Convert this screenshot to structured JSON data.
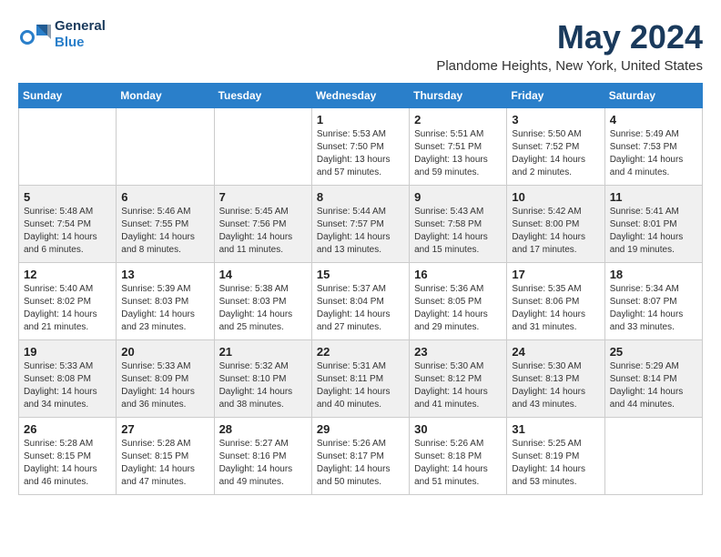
{
  "header": {
    "logo_line1": "General",
    "logo_line2": "Blue",
    "month": "May 2024",
    "location": "Plandome Heights, New York, United States"
  },
  "weekdays": [
    "Sunday",
    "Monday",
    "Tuesday",
    "Wednesday",
    "Thursday",
    "Friday",
    "Saturday"
  ],
  "weeks": [
    [
      {
        "day": "",
        "text": ""
      },
      {
        "day": "",
        "text": ""
      },
      {
        "day": "",
        "text": ""
      },
      {
        "day": "1",
        "text": "Sunrise: 5:53 AM\nSunset: 7:50 PM\nDaylight: 13 hours\nand 57 minutes."
      },
      {
        "day": "2",
        "text": "Sunrise: 5:51 AM\nSunset: 7:51 PM\nDaylight: 13 hours\nand 59 minutes."
      },
      {
        "day": "3",
        "text": "Sunrise: 5:50 AM\nSunset: 7:52 PM\nDaylight: 14 hours\nand 2 minutes."
      },
      {
        "day": "4",
        "text": "Sunrise: 5:49 AM\nSunset: 7:53 PM\nDaylight: 14 hours\nand 4 minutes."
      }
    ],
    [
      {
        "day": "5",
        "text": "Sunrise: 5:48 AM\nSunset: 7:54 PM\nDaylight: 14 hours\nand 6 minutes."
      },
      {
        "day": "6",
        "text": "Sunrise: 5:46 AM\nSunset: 7:55 PM\nDaylight: 14 hours\nand 8 minutes."
      },
      {
        "day": "7",
        "text": "Sunrise: 5:45 AM\nSunset: 7:56 PM\nDaylight: 14 hours\nand 11 minutes."
      },
      {
        "day": "8",
        "text": "Sunrise: 5:44 AM\nSunset: 7:57 PM\nDaylight: 14 hours\nand 13 minutes."
      },
      {
        "day": "9",
        "text": "Sunrise: 5:43 AM\nSunset: 7:58 PM\nDaylight: 14 hours\nand 15 minutes."
      },
      {
        "day": "10",
        "text": "Sunrise: 5:42 AM\nSunset: 8:00 PM\nDaylight: 14 hours\nand 17 minutes."
      },
      {
        "day": "11",
        "text": "Sunrise: 5:41 AM\nSunset: 8:01 PM\nDaylight: 14 hours\nand 19 minutes."
      }
    ],
    [
      {
        "day": "12",
        "text": "Sunrise: 5:40 AM\nSunset: 8:02 PM\nDaylight: 14 hours\nand 21 minutes."
      },
      {
        "day": "13",
        "text": "Sunrise: 5:39 AM\nSunset: 8:03 PM\nDaylight: 14 hours\nand 23 minutes."
      },
      {
        "day": "14",
        "text": "Sunrise: 5:38 AM\nSunset: 8:03 PM\nDaylight: 14 hours\nand 25 minutes."
      },
      {
        "day": "15",
        "text": "Sunrise: 5:37 AM\nSunset: 8:04 PM\nDaylight: 14 hours\nand 27 minutes."
      },
      {
        "day": "16",
        "text": "Sunrise: 5:36 AM\nSunset: 8:05 PM\nDaylight: 14 hours\nand 29 minutes."
      },
      {
        "day": "17",
        "text": "Sunrise: 5:35 AM\nSunset: 8:06 PM\nDaylight: 14 hours\nand 31 minutes."
      },
      {
        "day": "18",
        "text": "Sunrise: 5:34 AM\nSunset: 8:07 PM\nDaylight: 14 hours\nand 33 minutes."
      }
    ],
    [
      {
        "day": "19",
        "text": "Sunrise: 5:33 AM\nSunset: 8:08 PM\nDaylight: 14 hours\nand 34 minutes."
      },
      {
        "day": "20",
        "text": "Sunrise: 5:33 AM\nSunset: 8:09 PM\nDaylight: 14 hours\nand 36 minutes."
      },
      {
        "day": "21",
        "text": "Sunrise: 5:32 AM\nSunset: 8:10 PM\nDaylight: 14 hours\nand 38 minutes."
      },
      {
        "day": "22",
        "text": "Sunrise: 5:31 AM\nSunset: 8:11 PM\nDaylight: 14 hours\nand 40 minutes."
      },
      {
        "day": "23",
        "text": "Sunrise: 5:30 AM\nSunset: 8:12 PM\nDaylight: 14 hours\nand 41 minutes."
      },
      {
        "day": "24",
        "text": "Sunrise: 5:30 AM\nSunset: 8:13 PM\nDaylight: 14 hours\nand 43 minutes."
      },
      {
        "day": "25",
        "text": "Sunrise: 5:29 AM\nSunset: 8:14 PM\nDaylight: 14 hours\nand 44 minutes."
      }
    ],
    [
      {
        "day": "26",
        "text": "Sunrise: 5:28 AM\nSunset: 8:15 PM\nDaylight: 14 hours\nand 46 minutes."
      },
      {
        "day": "27",
        "text": "Sunrise: 5:28 AM\nSunset: 8:15 PM\nDaylight: 14 hours\nand 47 minutes."
      },
      {
        "day": "28",
        "text": "Sunrise: 5:27 AM\nSunset: 8:16 PM\nDaylight: 14 hours\nand 49 minutes."
      },
      {
        "day": "29",
        "text": "Sunrise: 5:26 AM\nSunset: 8:17 PM\nDaylight: 14 hours\nand 50 minutes."
      },
      {
        "day": "30",
        "text": "Sunrise: 5:26 AM\nSunset: 8:18 PM\nDaylight: 14 hours\nand 51 minutes."
      },
      {
        "day": "31",
        "text": "Sunrise: 5:25 AM\nSunset: 8:19 PM\nDaylight: 14 hours\nand 53 minutes."
      },
      {
        "day": "",
        "text": ""
      }
    ]
  ]
}
